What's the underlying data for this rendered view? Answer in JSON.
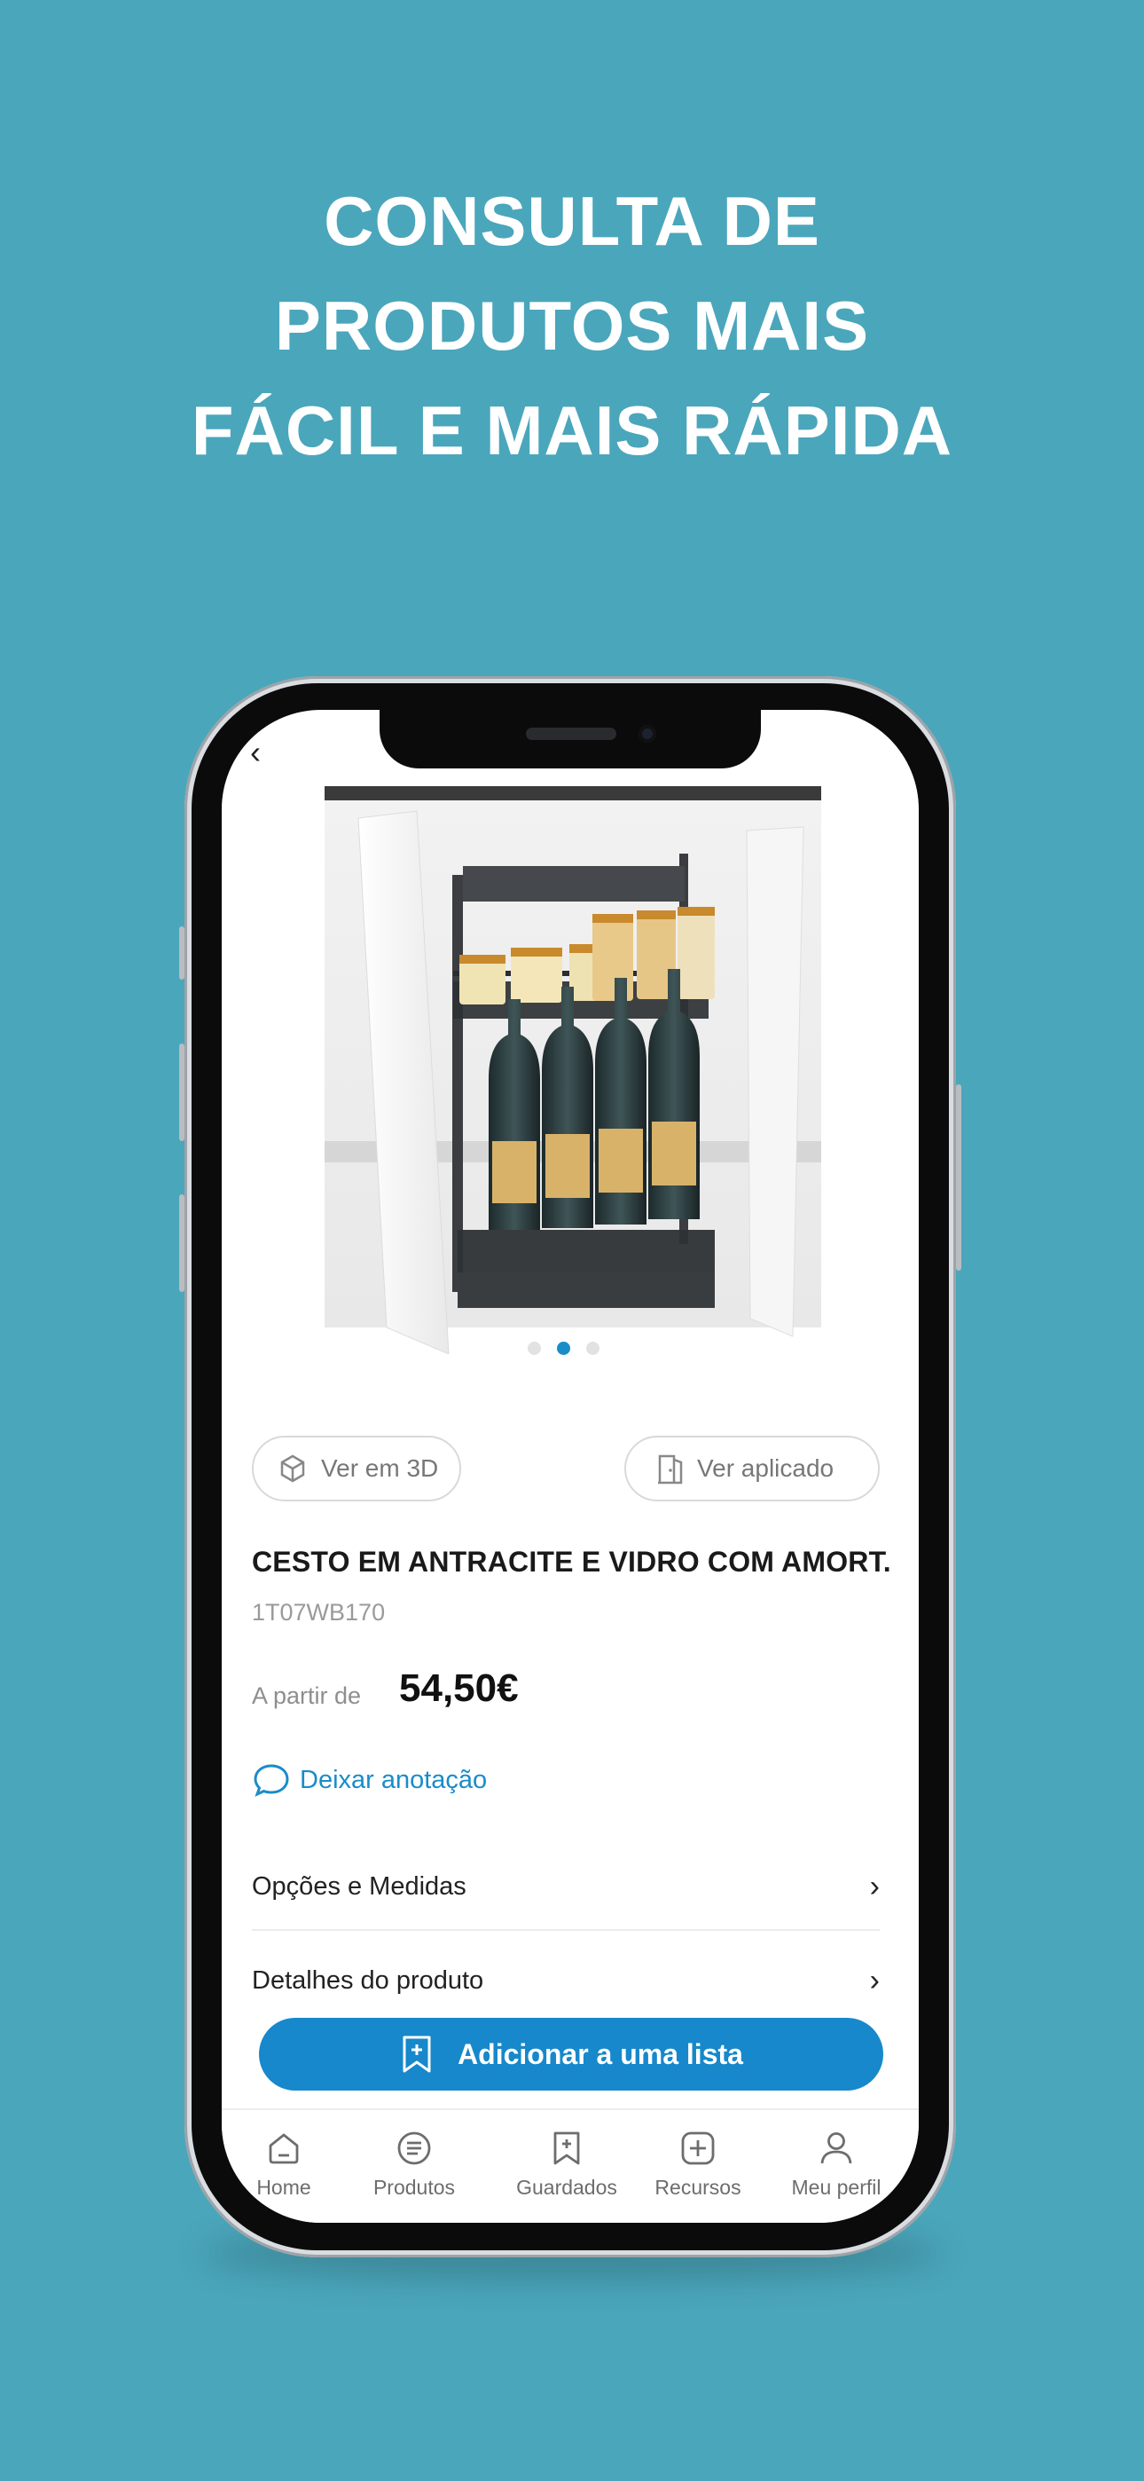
{
  "headline": {
    "line1": "CONSULTA DE",
    "line2": "PRODUTOS MAIS",
    "line3": "FÁCIL E MAIS RÁPIDA"
  },
  "nav": {
    "back_icon": "chevron-left-icon",
    "back_glyph": "‹"
  },
  "gallery": {
    "image_count": 3,
    "active_index": 1
  },
  "actions": {
    "view_3d": "Ver em 3D",
    "view_applied": "Ver aplicado"
  },
  "product": {
    "name": "CESTO EM ANTRACITE E VIDRO COM AMORT.",
    "code": "1T07WB170",
    "price_prefix": "A partir de",
    "price": "54,50€"
  },
  "note_link": "Deixar anotação",
  "rows": [
    {
      "label": "Opções e Medidas",
      "chevron": "›"
    },
    {
      "label": "Detalhes do produto",
      "chevron": "›"
    }
  ],
  "add_button": "Adicionar a uma lista",
  "tabs": [
    {
      "label": "Home",
      "icon": "home-icon"
    },
    {
      "label": "Produtos",
      "icon": "list-icon"
    },
    {
      "label": "Guardados",
      "icon": "bookmark-icon"
    },
    {
      "label": "Recursos",
      "icon": "plus-square-icon"
    },
    {
      "label": "Meu perfil",
      "icon": "user-icon"
    }
  ],
  "colors": {
    "background": "#4aa6bb",
    "accent": "#1688cb"
  }
}
